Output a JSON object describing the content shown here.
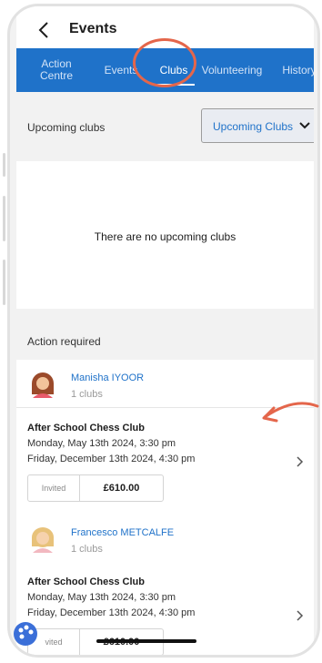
{
  "header": {
    "title": "Events"
  },
  "tabs": [
    {
      "label": "Action Centre",
      "active": false
    },
    {
      "label": "Events",
      "active": false
    },
    {
      "label": "Clubs",
      "active": true
    },
    {
      "label": "Volunteering",
      "active": false
    },
    {
      "label": "History",
      "active": false
    }
  ],
  "filter": {
    "label": "Upcoming clubs",
    "selected": "Upcoming Clubs"
  },
  "empty": {
    "message": "There are no upcoming clubs"
  },
  "action_required": {
    "label": "Action required",
    "entries": [
      {
        "name": "Manisha IYOOR",
        "sub": "1 clubs",
        "club": {
          "title": "After School Chess Club",
          "start": "Monday, May 13th 2024, 3:30 pm",
          "end": "Friday, December 13th 2024, 4:30 pm",
          "status": "Invited",
          "price": "£610.00"
        }
      },
      {
        "name": "Francesco METCALFE",
        "sub": "1 clubs",
        "club": {
          "title": "After School Chess Club",
          "start": "Monday, May 13th 2024, 3:30 pm",
          "end": "Friday, December 13th 2024, 4:30 pm",
          "status": "vited",
          "price": "£610.00"
        }
      }
    ]
  },
  "colors": {
    "brand_blue": "#1f72c9",
    "annotation": "#e4664b"
  }
}
